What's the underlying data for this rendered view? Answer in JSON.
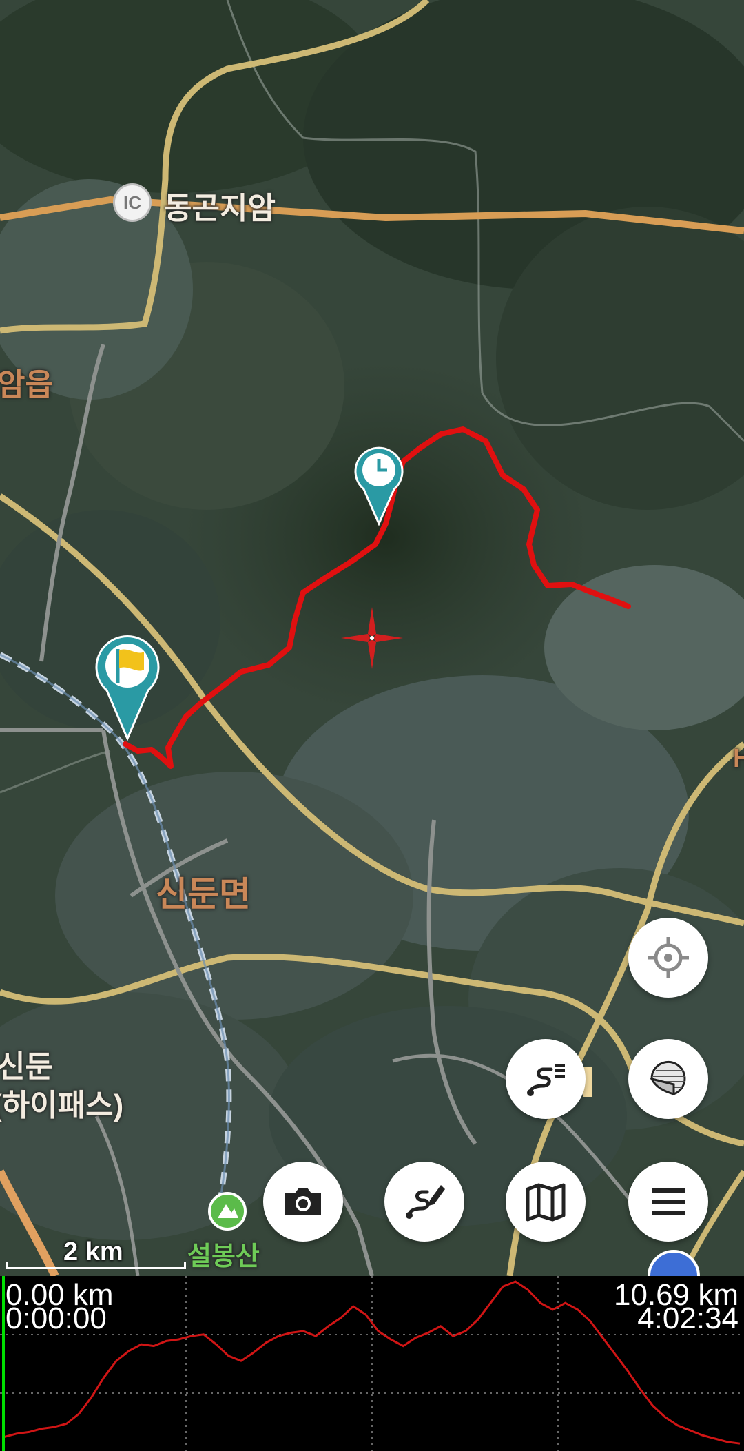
{
  "map": {
    "labels": {
      "dongon_ic": "동곤지암",
      "ic_badge": "IC",
      "gonjiam_eup": "암읍",
      "sindun_myeon": "신둔면",
      "sindun_hipass_line1": "신둔",
      "sindun_hipass_line2": "(하이패스)",
      "seolbongsan": "설봉산",
      "edge_char": "H"
    },
    "scale_label": "2 km",
    "colors": {
      "track": "#e01010",
      "pin": "#2a9aa4",
      "road_main": "#d8c27a",
      "road_orange": "#e0a060"
    },
    "markers": [
      "timer-pin",
      "start-flag-pin",
      "map-center-crosshair",
      "mountain-icon"
    ]
  },
  "controls": {
    "locate": "crosshair-icon",
    "layers": "page-curl-icon",
    "tracklist": "route-list-icon",
    "camera": "camera-icon",
    "draw_route": "route-edit-icon",
    "map_select": "map-icon",
    "menu": "hamburger-icon"
  },
  "profile": {
    "start_distance": "0.00 km",
    "start_time": "0:00:00",
    "end_distance": "10.69 km",
    "end_time": "4:02:34",
    "line_color": "#d01515",
    "cursor_color": "#00e000",
    "grid": true,
    "elevation_shape": [
      0.06,
      0.08,
      0.09,
      0.11,
      0.12,
      0.14,
      0.2,
      0.3,
      0.42,
      0.52,
      0.58,
      0.62,
      0.61,
      0.64,
      0.65,
      0.67,
      0.68,
      0.62,
      0.55,
      0.52,
      0.57,
      0.63,
      0.67,
      0.69,
      0.7,
      0.67,
      0.73,
      0.78,
      0.85,
      0.8,
      0.7,
      0.65,
      0.61,
      0.66,
      0.69,
      0.73,
      0.67,
      0.7,
      0.77,
      0.87,
      0.97,
      1.0,
      0.95,
      0.87,
      0.83,
      0.87,
      0.83,
      0.76,
      0.66,
      0.56,
      0.46,
      0.35,
      0.25,
      0.18,
      0.13,
      0.1,
      0.07,
      0.05,
      0.03,
      0.02
    ]
  }
}
